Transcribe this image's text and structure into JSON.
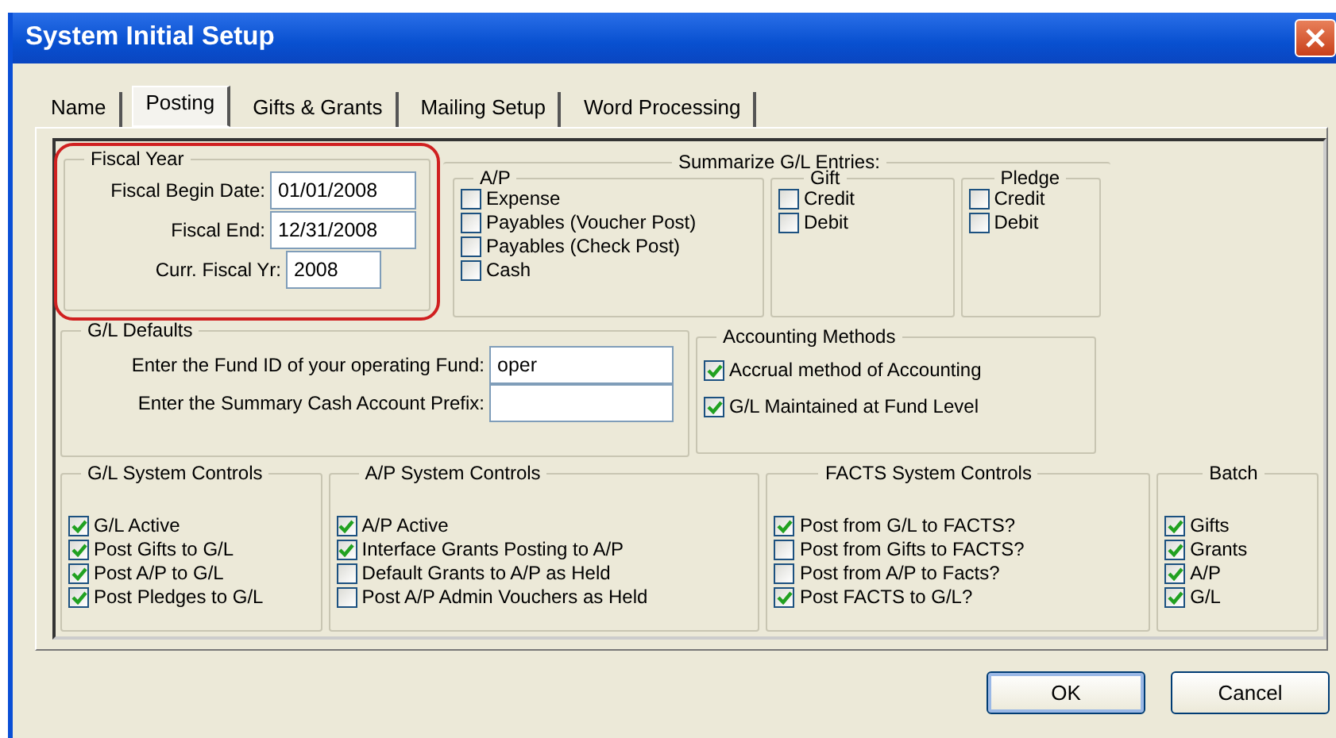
{
  "window": {
    "title": "System Initial Setup"
  },
  "tabs": [
    {
      "label": "Name",
      "selected": false
    },
    {
      "label": "Posting",
      "selected": true
    },
    {
      "label": "Gifts & Grants",
      "selected": false
    },
    {
      "label": "Mailing Setup",
      "selected": false
    },
    {
      "label": "Word Processing",
      "selected": false
    }
  ],
  "fiscal_year": {
    "legend": "Fiscal Year",
    "highlighted": true,
    "fields": [
      {
        "label": "Fiscal Begin Date:",
        "value": "01/01/2008"
      },
      {
        "label": "Fiscal End:",
        "value": "12/31/2008"
      },
      {
        "label": "Curr. Fiscal Yr:",
        "value": "2008"
      }
    ]
  },
  "summarize": {
    "legend": "Summarize G/L Entries:",
    "groups": [
      {
        "legend": "A/P",
        "options": [
          {
            "label": "Expense",
            "checked": false
          },
          {
            "label": "Payables (Voucher Post)",
            "checked": false
          },
          {
            "label": "Payables (Check Post)",
            "checked": false
          },
          {
            "label": "Cash",
            "checked": false
          }
        ]
      },
      {
        "legend": "Gift",
        "options": [
          {
            "label": "Credit",
            "checked": false
          },
          {
            "label": "Debit",
            "checked": false
          }
        ]
      },
      {
        "legend": "Pledge",
        "options": [
          {
            "label": "Credit",
            "checked": false
          },
          {
            "label": "Debit",
            "checked": false
          }
        ]
      }
    ]
  },
  "gl_defaults": {
    "legend": "G/L Defaults",
    "fields": [
      {
        "label": "Enter the Fund ID of your operating Fund:",
        "value": "oper"
      },
      {
        "label": "Enter the Summary Cash Account Prefix:"
      }
    ]
  },
  "accounting_methods": {
    "legend": "Accounting Methods",
    "options": [
      {
        "label": "Accrual method of Accounting",
        "checked": true
      },
      {
        "label": "G/L Maintained at Fund Level",
        "checked": true
      }
    ]
  },
  "control_groups": [
    {
      "legend": "G/L System Controls",
      "options": [
        {
          "label": "G/L Active",
          "checked": true
        },
        {
          "label": "Post Gifts to G/L",
          "checked": true
        },
        {
          "label": "Post A/P to G/L",
          "checked": true
        },
        {
          "label": "Post Pledges to G/L",
          "checked": true
        }
      ]
    },
    {
      "legend": "A/P System Controls",
      "options": [
        {
          "label": "A/P Active",
          "checked": true
        },
        {
          "label": "Interface Grants Posting to A/P",
          "checked": true
        },
        {
          "label": "Default Grants to A/P as Held",
          "checked": false
        },
        {
          "label": "Post A/P Admin Vouchers as Held",
          "checked": false
        }
      ]
    },
    {
      "legend": "FACTS System Controls",
      "options": [
        {
          "label": "Post from G/L to FACTS?",
          "checked": true
        },
        {
          "label": "Post from Gifts to FACTS?",
          "checked": false
        },
        {
          "label": "Post from A/P to Facts?",
          "checked": false
        },
        {
          "label": "Post FACTS to G/L?",
          "checked": true
        }
      ]
    },
    {
      "legend": "Batch",
      "options": [
        {
          "label": "Gifts",
          "checked": true
        },
        {
          "label": "Grants",
          "checked": true
        },
        {
          "label": "A/P",
          "checked": true
        },
        {
          "label": "G/L",
          "checked": true
        }
      ]
    }
  ],
  "buttons": [
    {
      "label": "OK",
      "default": true
    },
    {
      "label": "Cancel",
      "default": false
    }
  ]
}
